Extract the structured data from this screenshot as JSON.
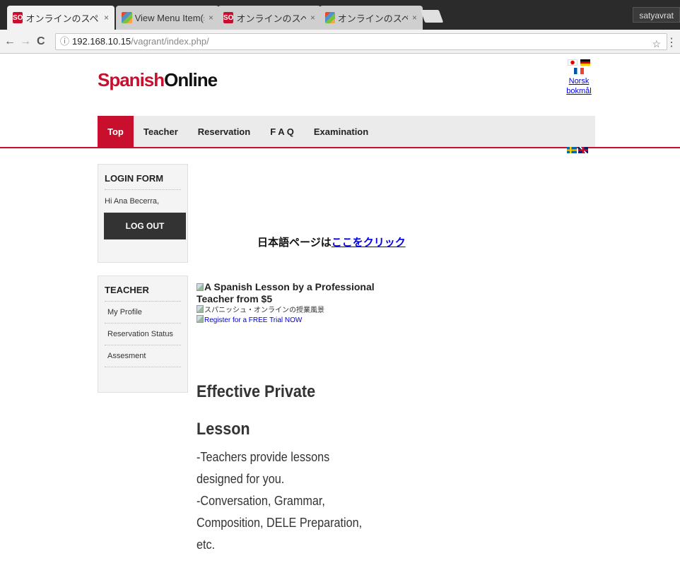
{
  "browser": {
    "tabs": [
      {
        "title": "オンラインのスペイ",
        "favicon": "so-icon",
        "active": true
      },
      {
        "title": "View Menu Item(s)",
        "favicon": "joomla-icon",
        "active": false
      },
      {
        "title": "オンラインのスペイ",
        "favicon": "so-icon",
        "active": false
      },
      {
        "title": "オンラインのスペイ",
        "favicon": "joomla-icon",
        "active": false
      }
    ],
    "tab_close": "×",
    "user": "satyavrat",
    "url_host": "192.168.10.15",
    "url_path": "/vagrant/index.php/",
    "back": "←",
    "forward": "→",
    "reload": "C",
    "info_icon": "ⓘ",
    "star": "☆",
    "menu": "⋮"
  },
  "site": {
    "logo_part1": "Spanish",
    "logo_part2": "Online",
    "brand_color": "#c8102e",
    "languages": {
      "norsk_line1": "Norsk",
      "norsk_line2": "bokmål"
    },
    "nav": [
      {
        "label": "Top",
        "active": true
      },
      {
        "label": "Teacher",
        "active": false
      },
      {
        "label": "Reservation",
        "active": false
      },
      {
        "label": "F A Q",
        "active": false
      },
      {
        "label": "Examination",
        "active": false
      }
    ]
  },
  "sidebar": {
    "login": {
      "title": "LOGIN FORM",
      "greeting": "Hi Ana Becerra,",
      "logout_label": "LOG OUT"
    },
    "teacher": {
      "title": "TEACHER",
      "links": [
        "My Profile",
        "Reservation Status",
        "Assesment"
      ]
    }
  },
  "main": {
    "jp_prefix": "日本語ページは",
    "jp_link": "ここをクリック",
    "img_title_line1": "A Spanish Lesson by a Professional",
    "img_title_line2": "Teacher from $5",
    "img_alt": "スパニッシュ・オンラインの授業風景",
    "img_register": "Register for a FREE Trial NOW",
    "heading_line1": "Effective Private",
    "heading_line2": "Lesson",
    "para_lines": [
      "-Teachers provide lessons",
      "designed for you.",
      "-Conversation, Grammar,",
      "Composition, DELE Preparation,",
      "etc."
    ]
  }
}
